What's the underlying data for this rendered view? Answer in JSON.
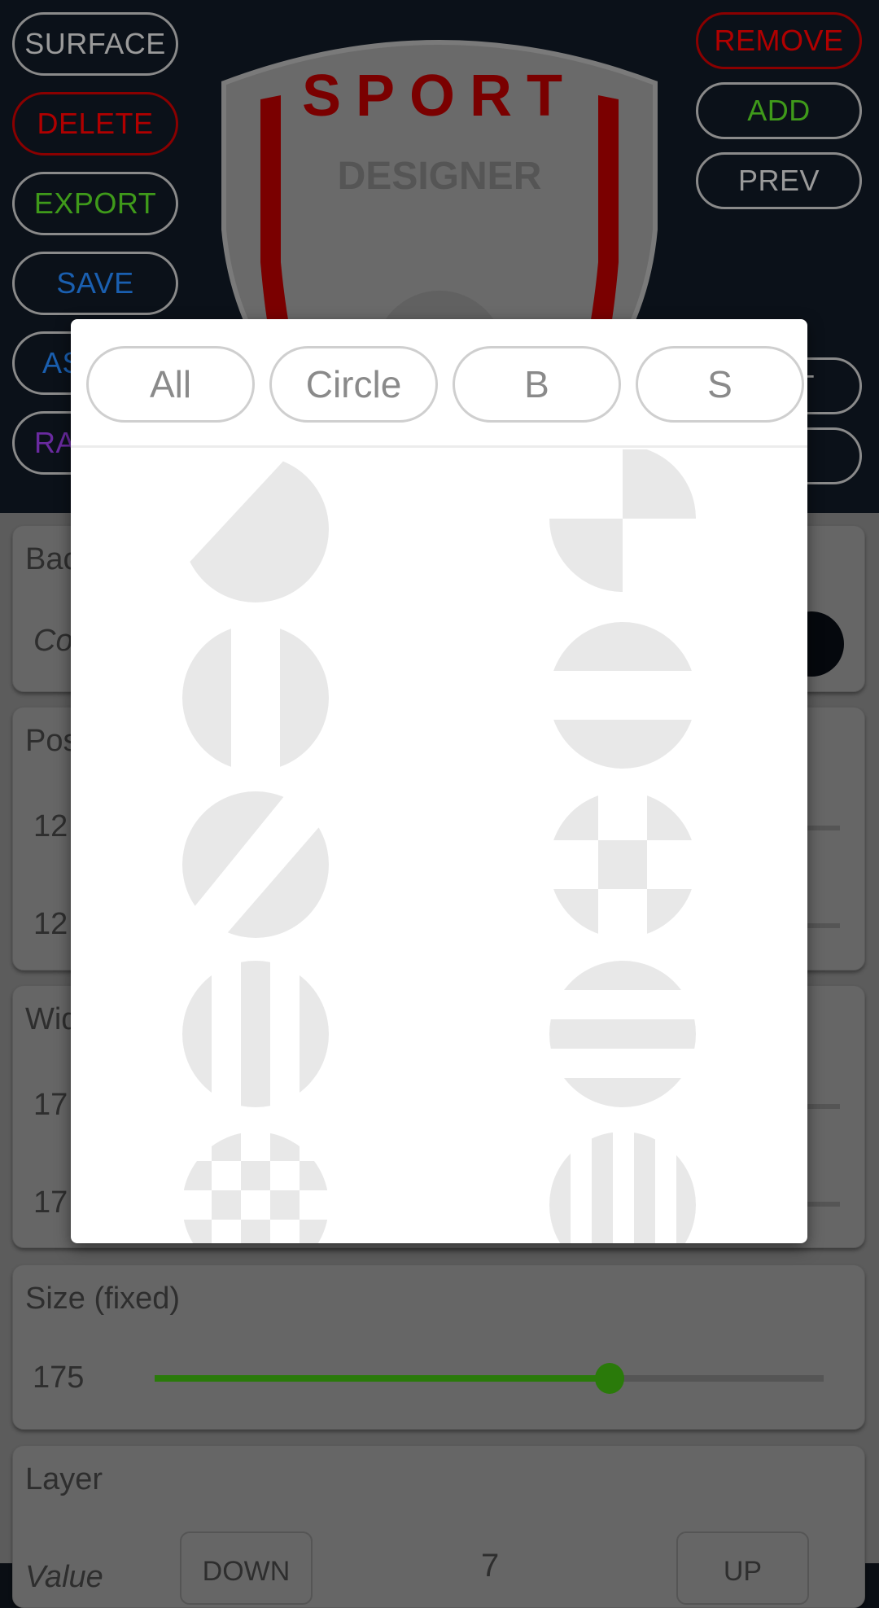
{
  "header": {
    "left_buttons": [
      {
        "label": "SURFACE",
        "color": "#9a9a9a"
      },
      {
        "label": "DELETE",
        "color": "#b00000"
      },
      {
        "label": "EXPORT",
        "color": "#3f9a1a"
      },
      {
        "label": "SAVE",
        "color": "#1a5fb0"
      },
      {
        "label": "AS",
        "color": "#1a5fb0"
      },
      {
        "label": "RA",
        "color": "#6a2aa0"
      }
    ],
    "right_buttons": [
      {
        "label": "REMOVE",
        "color": "#b00000"
      },
      {
        "label": "ADD",
        "color": "#3f9a1a"
      },
      {
        "label": "PREV",
        "color": "#9a9a9a"
      },
      {
        "label": "T",
        "color": "#9a9a9a"
      },
      {
        "label": "",
        "color": "#9a9a9a"
      }
    ],
    "logo": {
      "top_text": "SPORT",
      "bottom_text": "DESIGNER",
      "accent": "#7a0000"
    }
  },
  "settings": {
    "background_panel": {
      "title": "Bac",
      "row_label": "Co",
      "swatch_color": "#05080d"
    },
    "position_panel": {
      "title": "Pos",
      "x_value": "12",
      "y_value": "12"
    },
    "width_panel": {
      "title": "Wid",
      "a_value": "17",
      "b_value": "17"
    },
    "size_panel": {
      "title": "Size (fixed)",
      "value": "175",
      "slider_fraction": 0.68,
      "accent": "#2a7a0a"
    },
    "layer_panel": {
      "title": "Layer",
      "row_label": "Value",
      "down_label": "DOWN",
      "value": "7",
      "up_label": "UP"
    }
  },
  "dialog": {
    "tabs": [
      {
        "label": "All"
      },
      {
        "label": "Circle"
      },
      {
        "label": "B"
      },
      {
        "label": "S"
      }
    ],
    "shape_color": "#e8e8e8",
    "shapes": [
      {
        "name": "circle-diagonal-half"
      },
      {
        "name": "circle-quarters"
      },
      {
        "name": "circle-vertical-band"
      },
      {
        "name": "circle-horizontal-band"
      },
      {
        "name": "circle-diagonal-band"
      },
      {
        "name": "circle-cross-check"
      },
      {
        "name": "circle-vertical-stripes"
      },
      {
        "name": "circle-horizontal-stripes"
      },
      {
        "name": "circle-checkerboard"
      },
      {
        "name": "circle-thin-vertical-stripes"
      }
    ]
  }
}
